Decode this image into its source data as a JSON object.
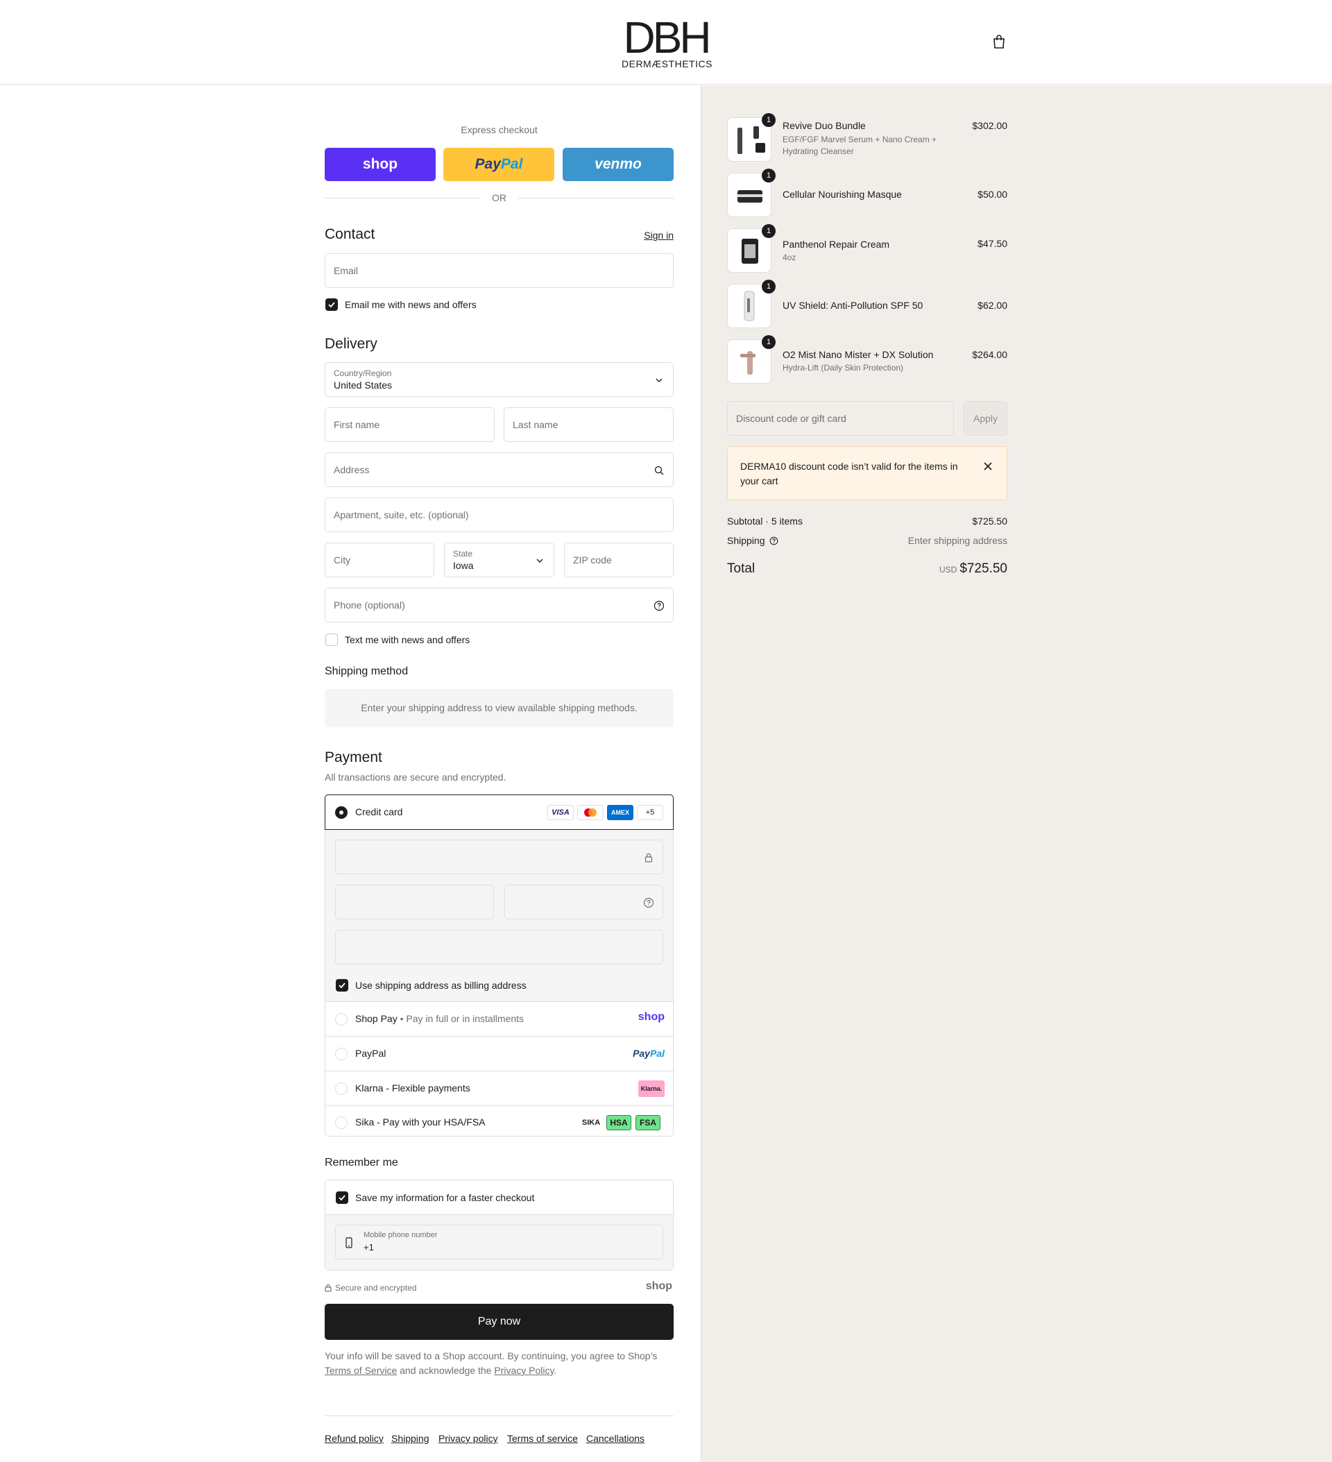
{
  "brand": {
    "name": "DBH",
    "tagline": "DERMÆSTHETICS"
  },
  "express": {
    "title": "Express checkout",
    "shop_label": "shop",
    "paypal_label_a": "Pay",
    "paypal_label_b": "Pal",
    "venmo_label": "venmo",
    "or_label": "OR",
    "colors": {
      "shop": "#5a31f4",
      "paypal": "#ffc439",
      "venmo": "#3d95ce"
    }
  },
  "contact": {
    "heading": "Contact",
    "sign_in": "Sign in",
    "email_placeholder": "Email",
    "news_checkbox": "Email me with news and offers"
  },
  "delivery": {
    "heading": "Delivery",
    "country_label": "Country/Region",
    "country_value": "United States",
    "first_name": "First name",
    "last_name": "Last name",
    "address": "Address",
    "apartment": "Apartment, suite, etc. (optional)",
    "city": "City",
    "state_label": "State",
    "state_value": "Iowa",
    "zip": "ZIP code",
    "phone": "Phone (optional)",
    "text_checkbox": "Text me with news and offers"
  },
  "shipping_method": {
    "heading": "Shipping method",
    "info": "Enter your shipping address to view available shipping methods."
  },
  "payment": {
    "heading": "Payment",
    "subtitle": "All transactions are secure and encrypted.",
    "credit_card": "Credit card",
    "card_badges": {
      "visa": "VISA",
      "amex": "AMEX",
      "more": "+5"
    },
    "billing_checkbox": "Use shipping address as billing address",
    "shop_pay": "Shop Pay",
    "shop_pay_sub": "Pay in full or in installments",
    "shop_logo": "shop",
    "paypal": "PayPal",
    "paypal_logo_a": "Pay",
    "paypal_logo_b": "Pal",
    "klarna": "Klarna - Flexible payments",
    "klarna_logo": "Klarna.",
    "sika": "Sika - Pay with your HSA/FSA",
    "sika_logo": "SIKA",
    "hsa_logo": "HSA",
    "fsa_logo": "FSA"
  },
  "remember": {
    "heading": "Remember me",
    "save_checkbox": "Save my information for a faster checkout",
    "mobile_label": "Mobile phone number",
    "mobile_value": "+1"
  },
  "secure": {
    "text": "Secure and encrypted",
    "shop_logo": "shop"
  },
  "pay_now": "Pay now",
  "legal": {
    "text_a": "Your info will be saved to a Shop account. By continuing, you agree to Shop’s",
    "terms": "Terms of Service",
    "text_b": "and acknowledge the",
    "privacy": "Privacy Policy",
    "text_c": "."
  },
  "footer": {
    "links": [
      "Refund policy",
      "Shipping",
      "Privacy policy",
      "Terms of service",
      "Cancellations"
    ]
  },
  "cart": {
    "items": [
      {
        "qty": "1",
        "name": "Revive Duo Bundle",
        "sub": "EGF/FGF Marvel Serum + Nano Cream + Hydrating Cleanser",
        "price": "$302.00"
      },
      {
        "qty": "1",
        "name": "Cellular Nourishing Masque",
        "sub": "",
        "price": "$50.00"
      },
      {
        "qty": "1",
        "name": "Panthenol Repair Cream",
        "sub": "4oz",
        "price": "$47.50"
      },
      {
        "qty": "1",
        "name": "UV Shield: Anti-Pollution SPF 50",
        "sub": "",
        "price": "$62.00"
      },
      {
        "qty": "1",
        "name": "O2 Mist Nano Mister + DX Solution",
        "sub": "Hydra-Lift (Daily Skin Protection)",
        "price": "$264.00"
      }
    ],
    "discount_placeholder": "Discount code or gift card",
    "apply": "Apply",
    "notice": "DERMA10 discount code isn’t valid for the items in your cart",
    "subtotal_label": "Subtotal · 5 items",
    "subtotal_value": "$725.50",
    "shipping_label": "Shipping",
    "shipping_value": "Enter shipping address",
    "total_label": "Total",
    "total_currency": "USD",
    "total_value": "$725.50"
  }
}
